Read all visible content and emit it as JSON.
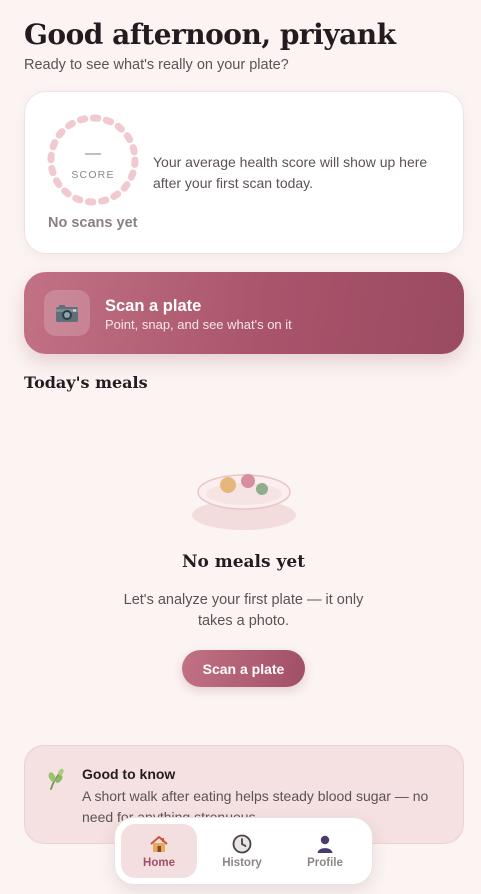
{
  "header": {
    "greeting": "Good afternoon, priyank",
    "subtitle": "Ready to see what's really on your plate?"
  },
  "score_card": {
    "score_value": "—",
    "score_label": "SCORE",
    "status": "No scans yet",
    "description": "Your average health score will show up here after your first scan today."
  },
  "scan_card": {
    "icon": "camera-icon",
    "title": "Scan a plate",
    "subtitle": "Point, snap, and see what's on it"
  },
  "meals": {
    "section_title": "Today's meals",
    "empty_title": "No meals yet",
    "empty_text": "Let's analyze your first plate — it only takes a photo.",
    "button_label": "Scan a plate"
  },
  "tip": {
    "icon": "herb-icon",
    "title": "Good to know",
    "text": "A short walk after eating helps steady blood sugar — no need for anything strenuous."
  },
  "tabs": [
    {
      "label": "Home",
      "icon": "home-icon",
      "active": true
    },
    {
      "label": "History",
      "icon": "clock-icon",
      "active": false
    },
    {
      "label": "Profile",
      "icon": "person-icon",
      "active": false
    }
  ],
  "colors": {
    "accent": "#a9546b",
    "background": "#fbf4f2",
    "tip_background": "#f5e1e1"
  }
}
